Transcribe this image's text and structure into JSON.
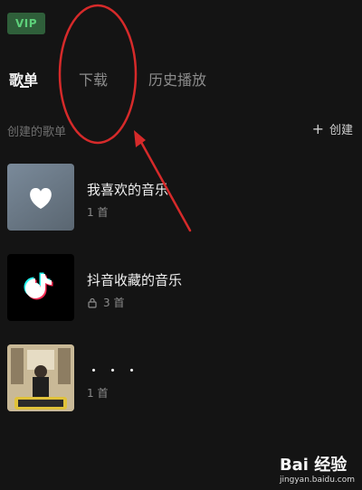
{
  "badges": {
    "vip": "VIP"
  },
  "tabs": [
    {
      "label": "歌单",
      "active": true
    },
    {
      "label": "下载",
      "active": false
    },
    {
      "label": "历史播放",
      "active": false
    }
  ],
  "section": {
    "label": "创建的歌单",
    "create": "创建"
  },
  "playlists": [
    {
      "title": "我喜欢的音乐",
      "meta": "1 首",
      "cover": "heart-icon"
    },
    {
      "title": "抖音收藏的音乐",
      "meta": "3 首",
      "cover": "tiktok-logo-icon",
      "locked": true
    },
    {
      "title": "・・・",
      "meta": "1 首",
      "cover": "album-art"
    }
  ],
  "watermark": {
    "brand": "Bai 经验",
    "url": "jingyan.baidu.com"
  },
  "colors": {
    "background": "#141414",
    "vip_bg": "#2f5f3a",
    "vip_text": "#5dd07a",
    "annotation": "#d62a2a"
  }
}
